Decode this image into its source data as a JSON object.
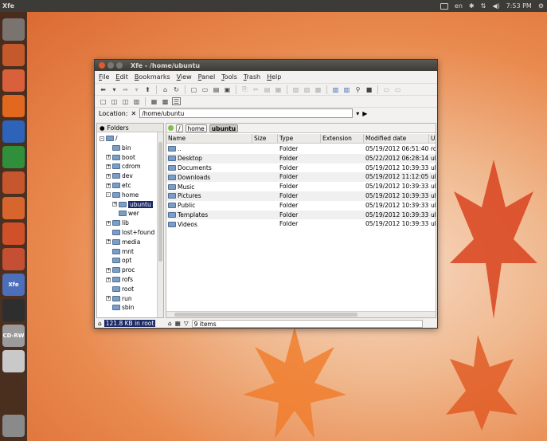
{
  "top_panel": {
    "app_name": "Xfe",
    "keyboard_layout": "en",
    "time": "7:53 PM",
    "icons": [
      "keyboard-icon",
      "bluetooth-icon",
      "network-icon",
      "volume-icon",
      "gear-icon"
    ]
  },
  "launcher": {
    "items": [
      {
        "name": "dash-icon",
        "color": "#7a7470"
      },
      {
        "name": "files-icon",
        "color": "#c45a2c"
      },
      {
        "name": "home-folder-icon",
        "color": "#d9603a"
      },
      {
        "name": "firefox-icon",
        "color": "#e2671f"
      },
      {
        "name": "writer-icon",
        "color": "#2d63b8"
      },
      {
        "name": "calc-icon",
        "color": "#2f8f3a"
      },
      {
        "name": "impress-icon",
        "color": "#c5562e"
      },
      {
        "name": "software-center-icon",
        "color": "#d8652c"
      },
      {
        "name": "ubuntu-one-icon",
        "color": "#d0502a"
      },
      {
        "name": "system-settings-icon",
        "color": "#c44f33"
      },
      {
        "name": "xfe-icon",
        "color": "#4d6fb9",
        "label": "Xfe"
      },
      {
        "name": "terminal-icon",
        "color": "#2e2e2e"
      },
      {
        "name": "cd-rw-icon",
        "color": "#9b9b9b",
        "label": "CD-RW"
      },
      {
        "name": "drive-icon",
        "color": "#c9c9c9"
      },
      {
        "name": "trash-icon",
        "color": "#8a8a8a"
      }
    ]
  },
  "window": {
    "title": "Xfe - /home/ubuntu",
    "menu": [
      "File",
      "Edit",
      "Bookmarks",
      "View",
      "Panel",
      "Tools",
      "Trash",
      "Help"
    ],
    "location_label": "Location:",
    "location_value": "/home/ubuntu",
    "tree_header": "Folders",
    "tree": [
      {
        "label": "/",
        "indent": 0,
        "exp": "-"
      },
      {
        "label": "bin",
        "indent": 1,
        "exp": ""
      },
      {
        "label": "boot",
        "indent": 1,
        "exp": "+"
      },
      {
        "label": "cdrom",
        "indent": 1,
        "exp": "+"
      },
      {
        "label": "dev",
        "indent": 1,
        "exp": "+"
      },
      {
        "label": "etc",
        "indent": 1,
        "exp": "+"
      },
      {
        "label": "home",
        "indent": 1,
        "exp": "-"
      },
      {
        "label": "ubuntu",
        "indent": 2,
        "exp": "+",
        "selected": true
      },
      {
        "label": "wer",
        "indent": 2,
        "exp": ""
      },
      {
        "label": "lib",
        "indent": 1,
        "exp": "+"
      },
      {
        "label": "lost+found",
        "indent": 1,
        "exp": ""
      },
      {
        "label": "media",
        "indent": 1,
        "exp": "+"
      },
      {
        "label": "mnt",
        "indent": 1,
        "exp": ""
      },
      {
        "label": "opt",
        "indent": 1,
        "exp": ""
      },
      {
        "label": "proc",
        "indent": 1,
        "exp": "+"
      },
      {
        "label": "rofs",
        "indent": 1,
        "exp": "+"
      },
      {
        "label": "root",
        "indent": 1,
        "exp": ""
      },
      {
        "label": "run",
        "indent": 1,
        "exp": "+"
      },
      {
        "label": "sbin",
        "indent": 1,
        "exp": ""
      }
    ],
    "breadcrumbs": [
      "/",
      "home",
      "ubuntu"
    ],
    "columns": [
      "Name",
      "Size",
      "Type",
      "Extension",
      "Modified date",
      "Us"
    ],
    "files": [
      {
        "name": "..",
        "size": "",
        "type": "Folder",
        "ext": "",
        "date": "05/19/2012 06:51:40...",
        "user": "roo"
      },
      {
        "name": "Desktop",
        "size": "",
        "type": "Folder",
        "ext": "",
        "date": "05/22/2012 06:28:14...",
        "user": "ubu"
      },
      {
        "name": "Documents",
        "size": "",
        "type": "Folder",
        "ext": "",
        "date": "05/19/2012 10:39:33...",
        "user": "ubu"
      },
      {
        "name": "Downloads",
        "size": "",
        "type": "Folder",
        "ext": "",
        "date": "05/19/2012 11:12:05...",
        "user": "ubu"
      },
      {
        "name": "Music",
        "size": "",
        "type": "Folder",
        "ext": "",
        "date": "05/19/2012 10:39:33...",
        "user": "ubu"
      },
      {
        "name": "Pictures",
        "size": "",
        "type": "Folder",
        "ext": "",
        "date": "05/19/2012 10:39:33...",
        "user": "ubu"
      },
      {
        "name": "Public",
        "size": "",
        "type": "Folder",
        "ext": "",
        "date": "05/19/2012 10:39:33...",
        "user": "ubu"
      },
      {
        "name": "Templates",
        "size": "",
        "type": "Folder",
        "ext": "",
        "date": "05/19/2012 10:39:33...",
        "user": "ubu"
      },
      {
        "name": "Videos",
        "size": "",
        "type": "Folder",
        "ext": "",
        "date": "05/19/2012 10:39:33...",
        "user": "ubu"
      }
    ],
    "status_left": "121.8 KB in root",
    "status_right": "9 items"
  }
}
